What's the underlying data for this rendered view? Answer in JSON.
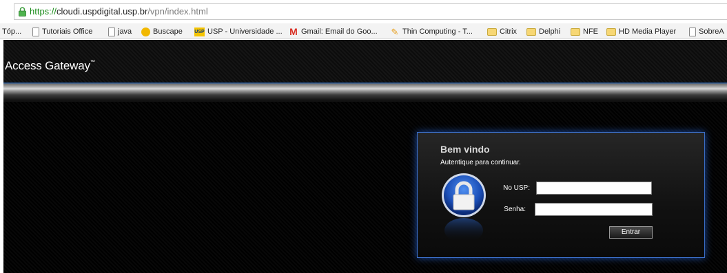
{
  "browser": {
    "url_protocol": "https://",
    "url_host": "cloudi.uspdigital.usp.br",
    "url_path": "/vpn/index.html"
  },
  "bookmarks": [
    {
      "label": "Tóp...",
      "icon": "none"
    },
    {
      "label": "Tutoriais Office",
      "icon": "page-icon"
    },
    {
      "label": "java",
      "icon": "page-icon"
    },
    {
      "label": "Buscape",
      "icon": "buscape-icon"
    },
    {
      "label": "USP - Universidade ...",
      "icon": "usp-icon"
    },
    {
      "label": "Gmail: Email do Goo...",
      "icon": "gmail-icon"
    },
    {
      "label": "Thin Computing - T...",
      "icon": "thin-computing-icon"
    },
    {
      "label": "Citrix",
      "icon": "folder-icon"
    },
    {
      "label": "Delphi",
      "icon": "folder-icon"
    },
    {
      "label": "NFE",
      "icon": "folder-icon"
    },
    {
      "label": "HD Media Player",
      "icon": "folder-icon"
    },
    {
      "label": "SobreA",
      "icon": "page-icon"
    }
  ],
  "gateway": {
    "title": "Access Gateway",
    "trademark": "™"
  },
  "login": {
    "welcome": "Bem vindo",
    "subtitle": "Autentique para continuar.",
    "user_label": "No USP:",
    "user_value": "",
    "password_label": "Senha:",
    "password_value": "",
    "submit_label": "Entrar"
  },
  "colors": {
    "panel_border": "#3b6fc9",
    "secure_protocol": "#168a16",
    "header_band_top": "#2d5fa0"
  }
}
